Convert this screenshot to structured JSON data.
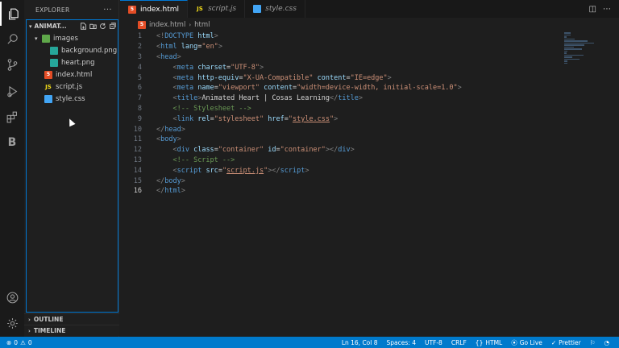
{
  "activity_bar": {
    "items": [
      {
        "icon": "files-icon",
        "active": true
      },
      {
        "icon": "search-icon"
      },
      {
        "icon": "source-control-icon"
      },
      {
        "icon": "run-debug-icon"
      },
      {
        "icon": "extensions-icon"
      },
      {
        "icon": "b-extension-icon",
        "letter": "B"
      }
    ],
    "bottom": [
      {
        "icon": "account-icon"
      },
      {
        "icon": "settings-gear-icon"
      }
    ]
  },
  "sidebar": {
    "title": "EXPLORER",
    "more": "···",
    "project": "ANIMAT...",
    "tree": [
      {
        "name": "images",
        "type": "folder",
        "depth": 1
      },
      {
        "name": "background.png",
        "type": "img",
        "depth": 2
      },
      {
        "name": "heart.png",
        "type": "img",
        "depth": 2
      },
      {
        "name": "index.html",
        "type": "html",
        "depth": 1
      },
      {
        "name": "script.js",
        "type": "js",
        "depth": 1
      },
      {
        "name": "style.css",
        "type": "css",
        "depth": 1
      }
    ],
    "outline": "OUTLINE",
    "timeline": "TIMELINE"
  },
  "tabs": [
    {
      "label": "index.html",
      "type": "html",
      "active": true
    },
    {
      "label": "script.js",
      "type": "js",
      "italic": true
    },
    {
      "label": "style.css",
      "type": "css",
      "italic": true
    }
  ],
  "breadcrumb": {
    "file": "index.html",
    "element": "html"
  },
  "editor": {
    "lines": [
      [
        [
          "br",
          "<!"
        ],
        [
          "tag",
          "DOCTYPE"
        ],
        [
          "attr",
          " html"
        ],
        [
          "br",
          ">"
        ]
      ],
      [
        [
          "br",
          "<"
        ],
        [
          "tag",
          "html"
        ],
        [
          "attr",
          " lang"
        ],
        [
          "txt",
          "="
        ],
        [
          "str",
          "\"en\""
        ],
        [
          "br",
          ">"
        ]
      ],
      [
        [
          "br",
          "<"
        ],
        [
          "tag",
          "head"
        ],
        [
          "br",
          ">"
        ]
      ],
      [
        [
          "txt",
          "    "
        ],
        [
          "br",
          "<"
        ],
        [
          "tag",
          "meta"
        ],
        [
          "attr",
          " charset"
        ],
        [
          "txt",
          "="
        ],
        [
          "str",
          "\"UTF-8\""
        ],
        [
          "br",
          ">"
        ]
      ],
      [
        [
          "txt",
          "    "
        ],
        [
          "br",
          "<"
        ],
        [
          "tag",
          "meta"
        ],
        [
          "attr",
          " http-equiv"
        ],
        [
          "txt",
          "="
        ],
        [
          "str",
          "\"X-UA-Compatible\""
        ],
        [
          "attr",
          " content"
        ],
        [
          "txt",
          "="
        ],
        [
          "str",
          "\"IE=edge\""
        ],
        [
          "br",
          ">"
        ]
      ],
      [
        [
          "txt",
          "    "
        ],
        [
          "br",
          "<"
        ],
        [
          "tag",
          "meta"
        ],
        [
          "attr",
          " name"
        ],
        [
          "txt",
          "="
        ],
        [
          "str",
          "\"viewport\""
        ],
        [
          "attr",
          " content"
        ],
        [
          "txt",
          "="
        ],
        [
          "str",
          "\"width=device-width, initial-scale=1.0\""
        ],
        [
          "br",
          ">"
        ]
      ],
      [
        [
          "txt",
          "    "
        ],
        [
          "br",
          "<"
        ],
        [
          "tag",
          "title"
        ],
        [
          "br",
          ">"
        ],
        [
          "txt",
          "Animated Heart | Cosas Learning"
        ],
        [
          "br",
          "</"
        ],
        [
          "tag",
          "title"
        ],
        [
          "br",
          ">"
        ]
      ],
      [
        [
          "txt",
          "    "
        ],
        [
          "com",
          "<!-- Stylesheet -->"
        ]
      ],
      [
        [
          "txt",
          "    "
        ],
        [
          "br",
          "<"
        ],
        [
          "tag",
          "link"
        ],
        [
          "attr",
          " rel"
        ],
        [
          "txt",
          "="
        ],
        [
          "str",
          "\"stylesheet\""
        ],
        [
          "attr",
          " href"
        ],
        [
          "txt",
          "="
        ],
        [
          "str",
          "\""
        ],
        [
          "stru",
          "style.css"
        ],
        [
          "str",
          "\""
        ],
        [
          "br",
          ">"
        ]
      ],
      [
        [
          "br",
          "</"
        ],
        [
          "tag",
          "head"
        ],
        [
          "br",
          ">"
        ]
      ],
      [
        [
          "br",
          "<"
        ],
        [
          "tag",
          "body"
        ],
        [
          "br",
          ">"
        ]
      ],
      [
        [
          "txt",
          "    "
        ],
        [
          "br",
          "<"
        ],
        [
          "tag",
          "div"
        ],
        [
          "attr",
          " class"
        ],
        [
          "txt",
          "="
        ],
        [
          "str",
          "\"container\""
        ],
        [
          "attr",
          " id"
        ],
        [
          "txt",
          "="
        ],
        [
          "str",
          "\"container\""
        ],
        [
          "br",
          "></"
        ],
        [
          "tag",
          "div"
        ],
        [
          "br",
          ">"
        ]
      ],
      [
        [
          "txt",
          "    "
        ],
        [
          "com",
          "<!-- Script -->"
        ]
      ],
      [
        [
          "txt",
          "    "
        ],
        [
          "br",
          "<"
        ],
        [
          "tag",
          "script"
        ],
        [
          "attr",
          " src"
        ],
        [
          "txt",
          "="
        ],
        [
          "str",
          "\""
        ],
        [
          "stru",
          "script.js"
        ],
        [
          "str",
          "\""
        ],
        [
          "br",
          "></"
        ],
        [
          "tag",
          "script"
        ],
        [
          "br",
          ">"
        ]
      ],
      [
        [
          "br",
          "</"
        ],
        [
          "tag",
          "body"
        ],
        [
          "br",
          ">"
        ]
      ],
      [
        [
          "br",
          "</"
        ],
        [
          "tag",
          "html"
        ],
        [
          "br",
          ">"
        ]
      ]
    ],
    "current_line": 16
  },
  "status": {
    "errors": "0",
    "warnings": "0",
    "position": "Ln 16, Col 8",
    "spaces": "Spaces: 4",
    "encoding": "UTF-8",
    "eol": "CRLF",
    "language": "HTML",
    "go_live": "Go Live",
    "prettier": "Prettier"
  },
  "colors": {
    "accent": "#007acc",
    "focus_border": "#0078d4"
  }
}
